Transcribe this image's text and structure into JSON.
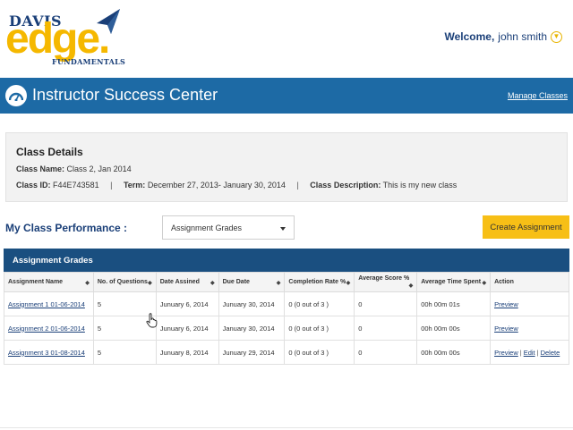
{
  "brand": {
    "davis": "DAVIS",
    "edge": "edge.",
    "fundamentals": "FUNDAMENTALS",
    "primary_color": "#1d6aa5",
    "accent_color": "#f7bf16"
  },
  "header": {
    "welcome_label": "Welcome,",
    "user_name": "john smith"
  },
  "titlebar": {
    "title": "Instructor Success Center",
    "manage_link": "Manage Classes"
  },
  "class_details": {
    "heading": "Class Details",
    "name_label": "Class Name:",
    "name_value": "Class 2, Jan 2014",
    "id_label": "Class ID:",
    "id_value": "F44E743581",
    "term_label": "Term:",
    "term_value": "December 27, 2013- January 30, 2014",
    "desc_label": "Class Description:",
    "desc_value": "This is my new class",
    "separator": "|"
  },
  "performance": {
    "label": "My Class Performance :",
    "selected_view": "Assignment Grades",
    "create_button": "Create Assignment"
  },
  "grades": {
    "panel_title": "Assignment Grades",
    "columns": [
      "Assignment Name",
      "No. of Questions",
      "Date Assined",
      "Due Date",
      "Completion Rate %",
      "Average Score %",
      "Average Time Spent",
      "Action"
    ],
    "rows": [
      {
        "name": "Assignment 1 01-06-2014",
        "questions": "5",
        "date_assigned": "Junuary 6, 2014",
        "due_date": "Junuary 30, 2014",
        "completion": "0 (0 out of 3 )",
        "avg_score": "0",
        "avg_time": "00h 00m 01s",
        "actions": [
          "Preview"
        ]
      },
      {
        "name": "Assignment 2 01-06-2014",
        "questions": "5",
        "date_assigned": "Junuary 6, 2014",
        "due_date": "January 30, 2014",
        "completion": "0 (0 out of 3 )",
        "avg_score": "0",
        "avg_time": "00h 00m 00s",
        "actions": [
          "Preview"
        ]
      },
      {
        "name": "Assignment 3 01-08-2014",
        "questions": "5",
        "date_assigned": "Junuary 8, 2014",
        "due_date": "Junuary 29, 2014",
        "completion": "0 (0 out of 3 )",
        "avg_score": "0",
        "avg_time": "00h 00m 00s",
        "actions": [
          "Preview",
          "Edit",
          "Delete"
        ]
      }
    ]
  }
}
